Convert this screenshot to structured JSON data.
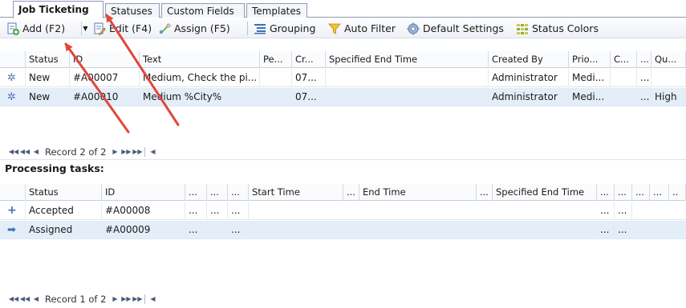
{
  "tabs": [
    "Job Ticketing",
    "Statuses",
    "Custom Fields",
    "Templates"
  ],
  "toolbar": {
    "add": "Add (F2)",
    "edit": "Edit (F4)",
    "assign": "Assign (F5)",
    "grouping": "Grouping",
    "auto_filter": "Auto Filter",
    "default_settings": "Default Settings",
    "status_colors": "Status Colors"
  },
  "main_grid": {
    "headers": [
      "Status",
      "ID",
      "Text",
      "Pe...",
      "Cr...",
      "Specified End Time",
      "Created By",
      "Prio...",
      "C...",
      "...",
      "Qu..."
    ],
    "rows": [
      {
        "status": "New",
        "id": "#A00007",
        "text": "Medium, Check the pi...",
        "pe": "",
        "cr": "07...",
        "end": "",
        "created_by": "Administrator",
        "prio": "Medi...",
        "c": "",
        "more": "...",
        "qu": ""
      },
      {
        "status": "New",
        "id": "#A00010",
        "text": "Medium %City%",
        "pe": "",
        "cr": "07...",
        "end": "",
        "created_by": "Administrator",
        "prio": "Medi...",
        "c": "",
        "more": "...",
        "qu": "High"
      }
    ],
    "navigator": "Record 2 of 2"
  },
  "processing": {
    "title": "Processing tasks:",
    "headers": [
      "Status",
      "ID",
      "...",
      "...",
      "...",
      "Start Time",
      "...",
      "End Time",
      "...",
      "Specified End Time",
      "...",
      "...",
      "...",
      "...",
      ".."
    ],
    "rows": [
      {
        "status": "Accepted",
        "id": "#A00008",
        "c1": "...",
        "c2": "...",
        "c3": "...",
        "s1": "...",
        "s2": "..."
      },
      {
        "status": "Assigned",
        "id": "#A00009",
        "c1": "...",
        "c2": "",
        "c3": "...",
        "s1": "...",
        "s2": "..."
      }
    ],
    "navigator": "Record 1 of 2"
  },
  "colors": {
    "annotation_arrow": "#e0473c",
    "selected_row": "#e3eef9"
  }
}
